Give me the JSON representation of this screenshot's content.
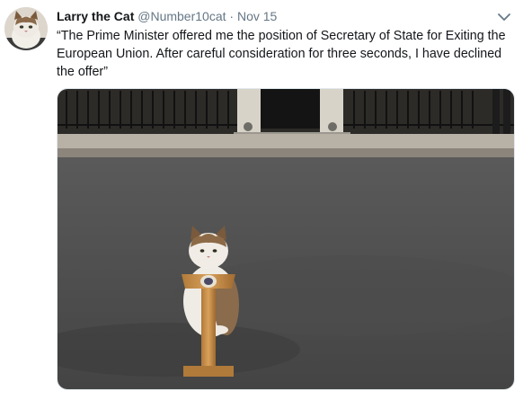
{
  "tweet": {
    "display_name": "Larry the Cat",
    "handle": "@Number10cat",
    "separator": "·",
    "date": "Nov 15",
    "text": "“The Prime Minister offered me the position of Secretary of State for Exiting the European Union. After careful consideration for three seconds, I have declined the offer”",
    "avatar_icon": "cat-avatar",
    "menu_icon": "chevron-down-icon",
    "photo": "cat-at-podium-photo"
  },
  "colors": {
    "name": "#14171a",
    "secondary": "#657786",
    "border": "#e1e8ed",
    "road": "#3e3e3e",
    "podium": "#c9914a"
  }
}
